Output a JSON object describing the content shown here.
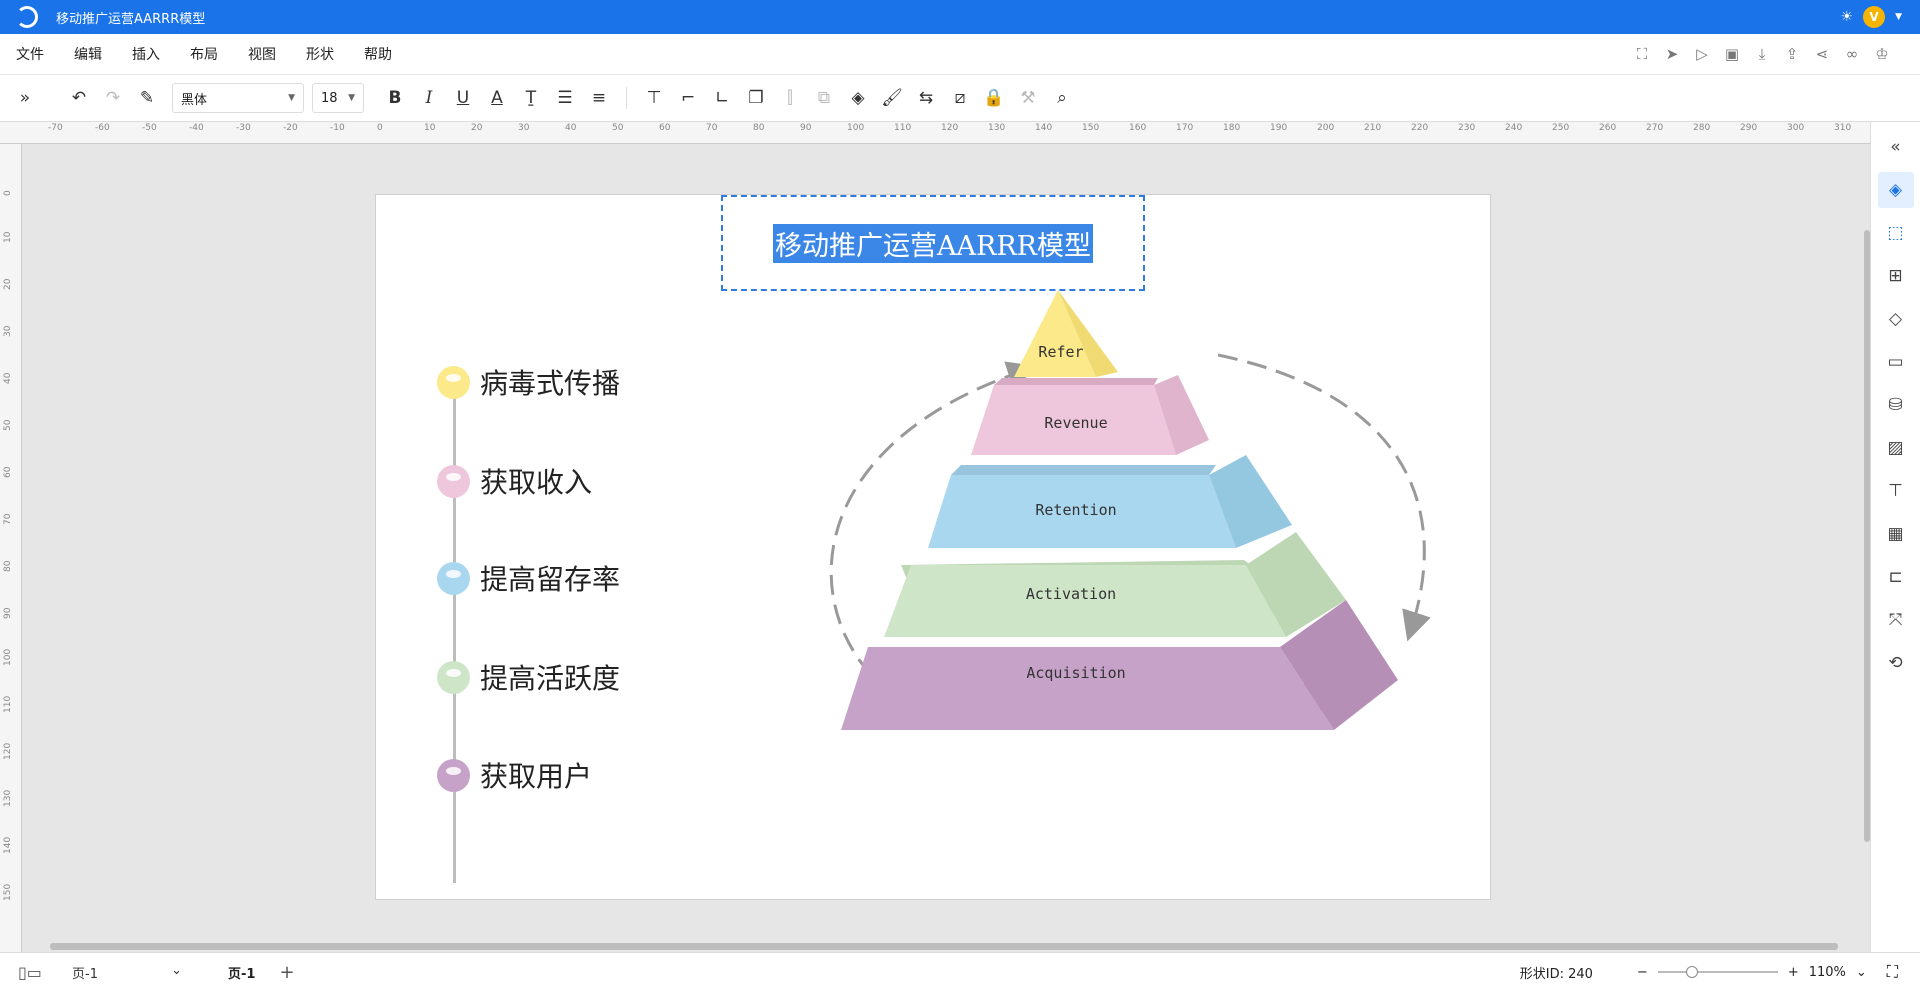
{
  "window": {
    "title": "移动推广运营AARRR模型"
  },
  "menu": [
    "文件",
    "编辑",
    "插入",
    "布局",
    "视图",
    "形状",
    "帮助"
  ],
  "toolbar": {
    "font": "黑体",
    "font_size": "18"
  },
  "ruler": {
    "horizontal": [
      "-70",
      "-60",
      "-50",
      "-40",
      "-30",
      "-20",
      "-10",
      "0",
      "10",
      "20",
      "30",
      "40",
      "50",
      "60",
      "70",
      "80",
      "90",
      "100",
      "110",
      "120",
      "130",
      "140",
      "150",
      "160",
      "170",
      "180",
      "190",
      "200",
      "210",
      "220",
      "230",
      "240",
      "250",
      "260",
      "270",
      "280",
      "290",
      "300",
      "310"
    ],
    "vertical": [
      "0",
      "10",
      "20",
      "30",
      "40",
      "50",
      "60",
      "70",
      "80",
      "90",
      "100",
      "110",
      "120",
      "130",
      "140",
      "150"
    ]
  },
  "diagram": {
    "title": "移动推广运营AARRR模型",
    "steps": [
      {
        "label": "病毒式传播",
        "color": "#fbe98a"
      },
      {
        "label": "获取收入",
        "color": "#eec7dc"
      },
      {
        "label": "提高留存率",
        "color": "#a9d7ef"
      },
      {
        "label": "提高活跃度",
        "color": "#cfe5c8"
      },
      {
        "label": "获取用户",
        "color": "#c6a2c8"
      }
    ],
    "pyramid": [
      "Refer",
      "Revenue",
      "Retention",
      "Activation",
      "Acquisition"
    ]
  },
  "status": {
    "page_select": "页-1",
    "page_tab": "页-1",
    "shape_id": "形状ID: 240",
    "zoom": "110%"
  }
}
